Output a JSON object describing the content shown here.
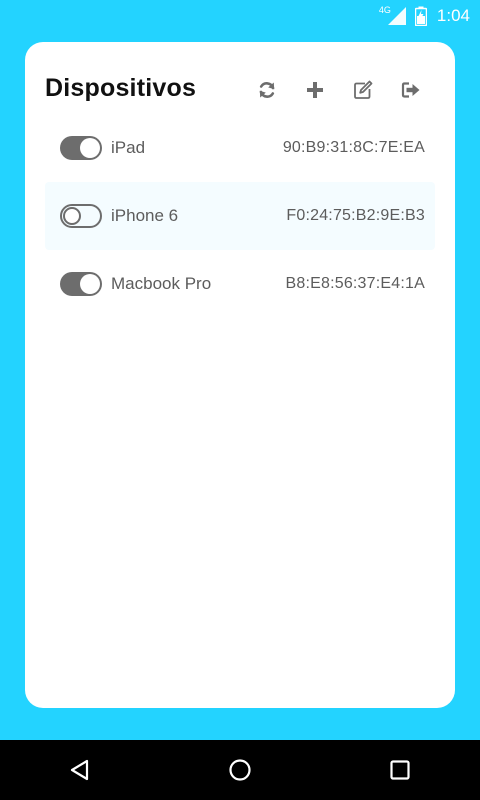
{
  "status_bar": {
    "network_type": "4G",
    "time": "1:04",
    "icons": [
      "signal-icon",
      "battery-icon"
    ]
  },
  "header": {
    "title": "Dispositivos",
    "actions": [
      {
        "name": "refresh",
        "icon": "refresh-icon"
      },
      {
        "name": "add",
        "icon": "plus-icon"
      },
      {
        "name": "edit",
        "icon": "edit-icon"
      },
      {
        "name": "logout",
        "icon": "sign-out-icon"
      }
    ]
  },
  "devices": [
    {
      "name": "iPad",
      "mac": "90:B9:31:8C:7E:EA",
      "enabled": true
    },
    {
      "name": "iPhone 6",
      "mac": "F0:24:75:B2:9E:B3",
      "enabled": false
    },
    {
      "name": "Macbook Pro",
      "mac": "B8:E8:56:37:E4:1A",
      "enabled": true
    }
  ],
  "nav_bar": {
    "buttons": [
      "back-icon",
      "home-icon",
      "recents-icon"
    ]
  },
  "colors": {
    "background": "#23d3ff",
    "card": "#ffffff",
    "toggle": "#6d6d6d",
    "text_secondary": "#5c5c5c",
    "row_highlight": "#f4fcff"
  }
}
